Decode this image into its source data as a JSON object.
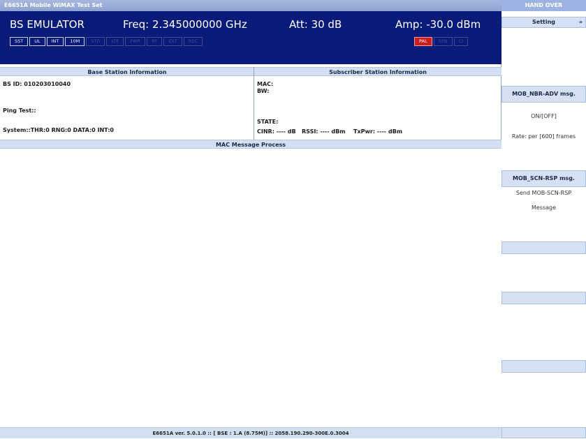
{
  "window": {
    "title": "E6651A Mobile WiMAX Test Set"
  },
  "header": {
    "mode": "BS EMULATOR",
    "freq": "Freq: 2.345000000 GHz",
    "att": "Att: 30 dB",
    "amp": "Amp: -30.0 dBm",
    "indicators": [
      "SST",
      "UL",
      "INT",
      "10M"
    ],
    "indicators_dim": [
      "STD",
      "LTE",
      "PWR",
      "RF",
      "EXT",
      "RSC"
    ],
    "right_indicators": [
      {
        "label": "PAL",
        "state": "active"
      },
      {
        "label": "SYN",
        "state": "dim"
      },
      {
        "label": "CI",
        "state": "dim"
      }
    ],
    "colors": {
      "background": "#0a1a78",
      "alarm": "#c81e1e"
    }
  },
  "bs_info": {
    "title": "Base Station Information",
    "bs_id": "BS ID: 010203010040",
    "ping": "Ping Test::",
    "system": "System::THR:0  RNG:0  DATA:0  INT:0"
  },
  "ss_info": {
    "title": "Subscriber Station Information",
    "mac": "MAC:",
    "bw": "BW:",
    "state": "STATE:",
    "cinr": "CINR: ---- dB",
    "rssi": "RSSI: ---- dBm",
    "txpwr": "TxPwr: ---- dBm"
  },
  "mac_process": {
    "title": "MAC Message Process"
  },
  "footer": {
    "text": "E6651A ver. 5.0.1.0 :: [ BSE : 1.A (8.75M)] :: 2058.190.290-300E.0.3004"
  },
  "side": {
    "title": "HAND OVER",
    "setting": "Setting",
    "setting_arrow": "»",
    "nbr_title": "MOB_NBR-ADV msg.",
    "nbr_toggle": "ON/[OFF]",
    "nbr_rate": "Rate: per [600] frames",
    "scn_title": "MOB_SCN-RSP msg.",
    "scn_line1": "Send MOB-SCN-RSP",
    "scn_line2": "Message"
  }
}
